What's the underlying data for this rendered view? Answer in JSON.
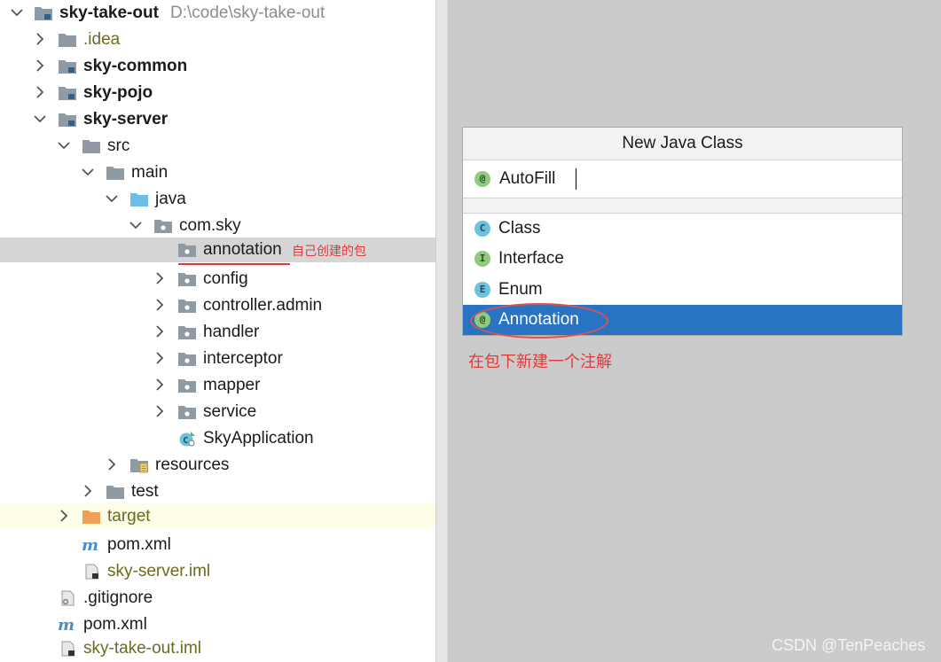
{
  "project": {
    "name": "sky-take-out",
    "path": "D:\\code\\sky-take-out",
    "tree": [
      {
        "label": ".idea"
      },
      {
        "label": "sky-common"
      },
      {
        "label": "sky-pojo"
      },
      {
        "label": "sky-server"
      },
      {
        "label": "src"
      },
      {
        "label": "main"
      },
      {
        "label": "java"
      },
      {
        "label": "com.sky"
      },
      {
        "label": "annotation"
      },
      {
        "label": "config"
      },
      {
        "label": "controller.admin"
      },
      {
        "label": "handler"
      },
      {
        "label": "interceptor"
      },
      {
        "label": "mapper"
      },
      {
        "label": "service"
      },
      {
        "label": "SkyApplication"
      },
      {
        "label": "resources"
      },
      {
        "label": "test"
      },
      {
        "label": "target"
      },
      {
        "label": "pom.xml"
      },
      {
        "label": "sky-server.iml"
      },
      {
        "label": ".gitignore"
      },
      {
        "label": "pom.xml"
      },
      {
        "label": "sky-take-out.iml"
      }
    ]
  },
  "annotations": {
    "package_note": "自己创建的包",
    "dialog_note": "在包下新建一个注解"
  },
  "dialog": {
    "title": "New Java Class",
    "input_value": "AutoFill",
    "options": [
      {
        "label": "Class",
        "badge": "C"
      },
      {
        "label": "Interface",
        "badge": "I"
      },
      {
        "label": "Enum",
        "badge": "E"
      },
      {
        "label": "Annotation",
        "badge": "@"
      }
    ],
    "input_badge": "@"
  },
  "watermark": "CSDN @TenPeaches",
  "colors": {
    "selection": "#2874c2",
    "annotation_red": "#e03b3b",
    "folder_gray": "#8f9aa4",
    "source_folder_blue": "#6cc0e8",
    "excluded_folder_orange": "#f0a055"
  }
}
